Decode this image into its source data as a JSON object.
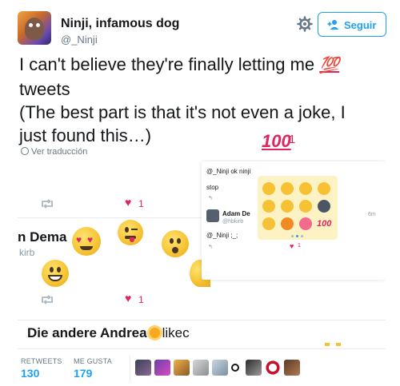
{
  "user": {
    "name": "Ninji, infamous dog",
    "handle": "@_Ninji"
  },
  "follow_button": {
    "label": "Seguir"
  },
  "tweet": {
    "line1": "I can't believe they're finally letting me",
    "emoji_100": "💯",
    "line2": "tweets",
    "line3": "(The best part is that it's not even a joke, I",
    "line4": "just found this…)",
    "translate_label": "Ver traducción"
  },
  "media": {
    "like_count_1": "1",
    "like_count_2": "1",
    "dema_name": "n Dema",
    "kirb_handle": "kirb",
    "andrea_prefix": "Die andere Andrea",
    "andrea_suffix": "likec",
    "phone": {
      "reply_header": "@_Ninji ok ninji",
      "stop_text": "stop",
      "adam_name": "Adam De",
      "adam_handle": "@hbkirb",
      "adam_time": "6m",
      "ninji_reply": "@_Ninji ;_;",
      "phone_like": "1"
    },
    "big_100": "100",
    "big_100_count": "1",
    "picker_100": "100"
  },
  "stats": {
    "retweets_label": "RETWEETS",
    "retweets_value": "130",
    "likes_label": "ME GUSTA",
    "likes_value": "179"
  },
  "colors": {
    "accent": "#1da1f2",
    "heart": "#e0245e",
    "emoji_yellow": "#f6c233"
  }
}
